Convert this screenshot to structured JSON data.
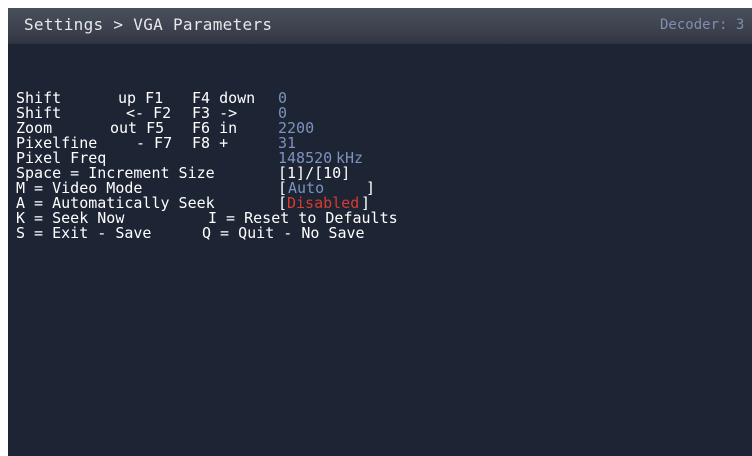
{
  "header": {
    "breadcrumb": "Settings > VGA Parameters",
    "decoder": "Decoder: 3"
  },
  "params": [
    {
      "name": "Shift",
      "dec_label": "up F1",
      "inc_label": "F4 down",
      "value": "0"
    },
    {
      "name": "Shift",
      "dec_label": "<- F2",
      "inc_label": "F3 ->",
      "value": "0"
    },
    {
      "name": "Zoom",
      "dec_label": "out F5",
      "inc_label": "F6 in",
      "value": "2200"
    },
    {
      "name": "Pixelfine",
      "dec_label": "- F7",
      "inc_label": "F8 +",
      "value": "31"
    }
  ],
  "pixel_freq": {
    "label": "Pixel Freq",
    "value": "148520",
    "unit": "kHz"
  },
  "increment": {
    "label": "Space = Increment Size",
    "value": "[1]/[10]"
  },
  "video_mode": {
    "label": "M = Video Mode",
    "bracket_open": "[",
    "value": "Auto",
    "bracket_close": "]"
  },
  "auto_seek": {
    "label": "A = Automatically Seek",
    "bracket_open": "[",
    "value": "Disabled",
    "bracket_close": "]"
  },
  "keys": {
    "seek_now": "K = Seek Now",
    "reset": "I = Reset to Defaults",
    "exit_save": "S = Exit - Save",
    "quit": "Q = Quit - No Save"
  },
  "colors": {
    "background": "#1d2434",
    "value": "#7d93bd",
    "disabled": "#d63b2f"
  }
}
